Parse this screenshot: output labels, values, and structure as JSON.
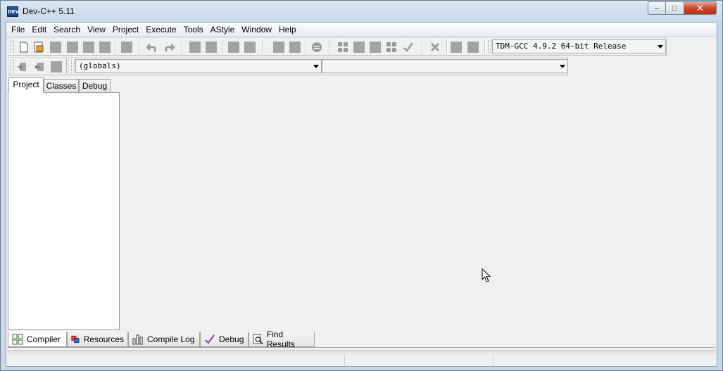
{
  "window": {
    "title": "Dev-C++ 5.11",
    "icon_label": "DEV"
  },
  "menu": [
    "File",
    "Edit",
    "Search",
    "View",
    "Project",
    "Execute",
    "Tools",
    "AStyle",
    "Window",
    "Help"
  ],
  "toolbar": {
    "compiler_select": "TDM-GCC 4.9.2 64-bit Release"
  },
  "class_browser": {
    "scope_select": "(globals)",
    "member_select": ""
  },
  "left_tabs": [
    "Project",
    "Classes",
    "Debug"
  ],
  "bottom_tabs": [
    "Compiler",
    "Resources",
    "Compile Log",
    "Debug",
    "Find Results"
  ],
  "icons": {
    "toolbar_main": [
      "new-file-icon",
      "open-project-icon",
      "save-icon",
      "save-all-icon",
      "close-icon",
      "close-all-icon",
      "print-icon",
      "undo-icon",
      "redo-icon",
      "find-icon",
      "replace-icon",
      "indent-icon",
      "unindent-icon",
      "toggle-bookmark-icon",
      "goto-bookmark-icon",
      "comment-icon",
      "compile-icon",
      "run-icon",
      "compile-run-icon",
      "rebuild-icon",
      "syntax-check-icon",
      "stop-icon",
      "debug-icon",
      "profile-icon"
    ],
    "toolbar_project": [
      "insert-icon",
      "remove-icon",
      "project-options-icon"
    ]
  }
}
